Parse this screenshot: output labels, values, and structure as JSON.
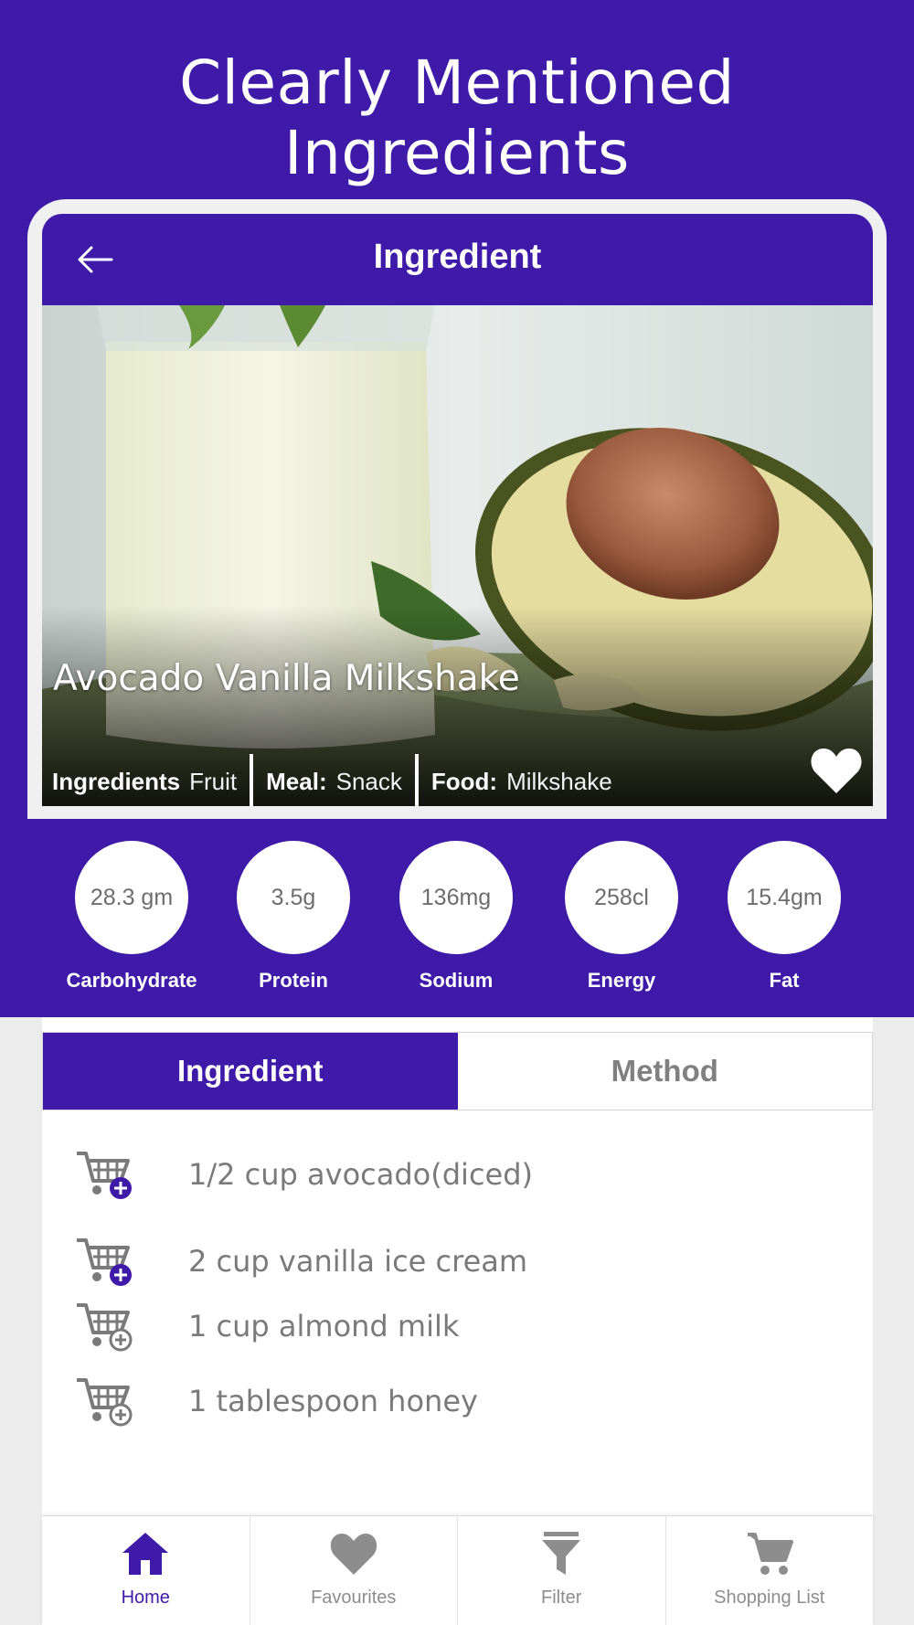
{
  "headline": "Clearly Mentioned Ingredients",
  "app": {
    "title": "Ingredient",
    "back_icon": "arrow-left-icon"
  },
  "recipe": {
    "name": "Avocado Vanilla Milkshake",
    "meta": {
      "ingredients_label": "Ingredients",
      "ingredients_value": "Fruit",
      "meal_label": "Meal:",
      "meal_value": "Snack",
      "food_label": "Food:",
      "food_value": "Milkshake"
    },
    "favourite_icon": "heart-icon"
  },
  "nutrition": [
    {
      "value": "28.3 gm",
      "label": "Carbohydrate"
    },
    {
      "value": "3.5g",
      "label": "Protein"
    },
    {
      "value": "136mg",
      "label": "Sodium"
    },
    {
      "value": "258cl",
      "label": "Energy"
    },
    {
      "value": "15.4gm",
      "label": "Fat"
    }
  ],
  "tabs": [
    {
      "label": "Ingredient",
      "active": true
    },
    {
      "label": "Method",
      "active": false
    }
  ],
  "ingredients": [
    {
      "text": "1/2 cup avocado(diced)",
      "icon": "cart-add-icon",
      "added": true
    },
    {
      "text": "2 cup vanilla ice cream",
      "icon": "cart-add-icon",
      "added": true
    },
    {
      "text": "1 cup almond milk",
      "icon": "cart-add-icon",
      "added": false
    },
    {
      "text": "1 tablespoon honey",
      "icon": "cart-add-icon",
      "added": false
    }
  ],
  "bottom_nav": [
    {
      "label": "Home",
      "icon": "home-icon",
      "active": true
    },
    {
      "label": "Favourites",
      "icon": "heart-icon",
      "active": false
    },
    {
      "label": "Filter",
      "icon": "filter-icon",
      "active": false
    },
    {
      "label": "Shopping List",
      "icon": "cart-icon",
      "active": false
    }
  ],
  "colors": {
    "primary": "#3f19a8",
    "muted_text": "#7a7a7a",
    "inactive_icon": "#8d8d8d"
  }
}
